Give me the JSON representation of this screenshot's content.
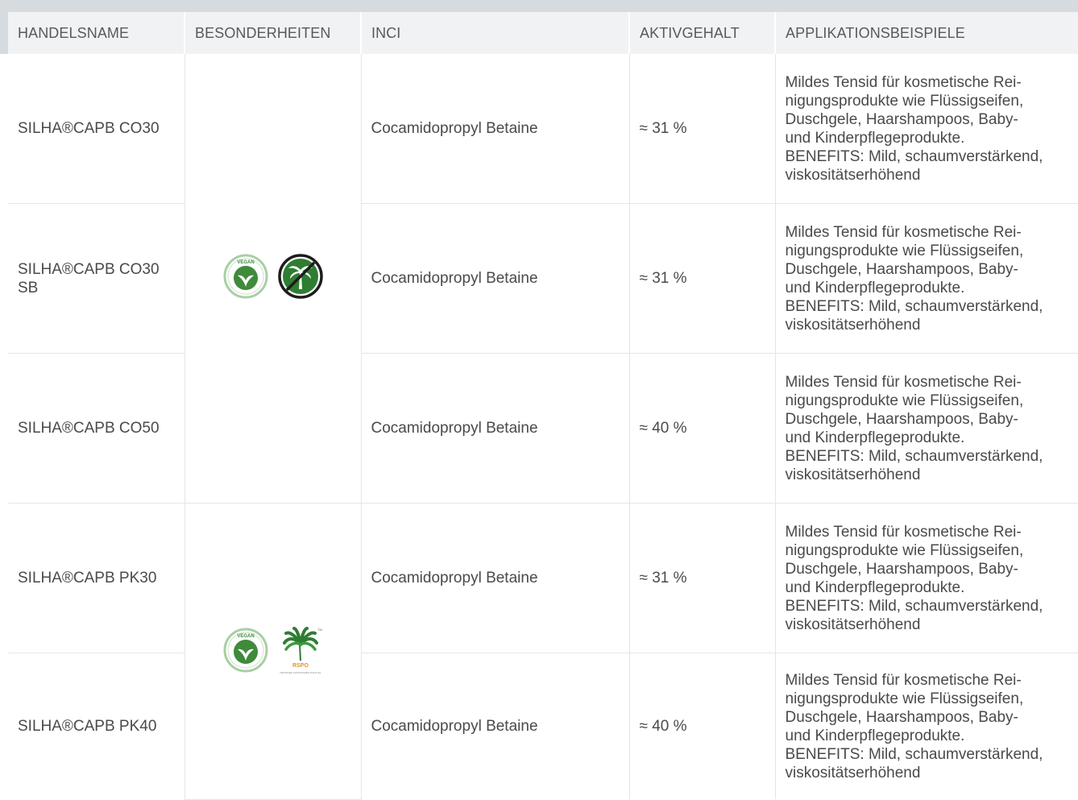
{
  "table": {
    "headers": [
      "HANDELSNAME",
      "BESONDERHEITEN",
      "INCI",
      "AKTIVGEHALT",
      "APPLIKATIONSBEISPIELE"
    ],
    "rows": [
      {
        "name": "SILHA®CAPB CO30",
        "inci": "Cocamidopropyl Betaine",
        "active": "≈ 31 %",
        "application": "Mildes Tensid für kosmetische Rei-\nnigungsprodukte wie Flüssigseifen,\nDuschgele, Haarshampoos, Baby-\nund Kinderpflegeprodukte.\nBENEFITS: Mild, schaumverstärkend,\nviskositätserhöhend"
      },
      {
        "name": "SILHA®CAPB CO30 SB",
        "inci": "Cocamidopropyl Betaine",
        "active": "≈ 31 %",
        "application": "Mildes Tensid für kosmetische Rei-\nnigungsprodukte wie Flüssigseifen,\nDuschgele, Haarshampoos, Baby-\nund Kinderpflegeprodukte.\nBENEFITS: Mild, schaumverstärkend,\nviskositätserhöhend"
      },
      {
        "name": "SILHA®CAPB CO50",
        "inci": "Cocamidopropyl Betaine",
        "active": "≈ 40 %",
        "application": "Mildes Tensid für kosmetische Rei-\nnigungsprodukte wie Flüssigseifen,\nDuschgele, Haarshampoos, Baby-\nund Kinderpflegeprodukte.\nBENEFITS: Mild, schaumverstärkend,\nviskositätserhöhend"
      },
      {
        "name": "SILHA®CAPB PK30",
        "inci": "Cocamidopropyl Betaine",
        "active": "≈ 31 %",
        "application": "Mildes Tensid für kosmetische Rei-\nnigungsprodukte wie Flüssigseifen,\nDuschgele, Haarshampoos, Baby-\nund Kinderpflegeprodukte.\nBENEFITS: Mild, schaumverstärkend,\nviskositätserhöhend"
      },
      {
        "name": "SILHA®CAPB PK40",
        "inci": "Cocamidopropyl Betaine",
        "active": "≈ 40 %",
        "application": "Mildes Tensid für kosmetische Rei-\nnigungsprodukte wie Flüssigseifen,\nDuschgele, Haarshampoos, Baby-\nund Kinderpflegeprodukte.\nBENEFITS: Mild, schaumverstärkend,\nviskositätserhöhend"
      }
    ],
    "badge_groups": [
      {
        "icons": [
          "vegan-icon",
          "palm-free-icon"
        ],
        "vegan_text": "VEGAN"
      },
      {
        "icons": [
          "vegan-icon",
          "rspo-icon"
        ],
        "vegan_text": "VEGAN",
        "rspo_text": "RSPO",
        "rspo_arc_text": "CERTIFIED SUSTAINABLE PALM OIL",
        "rspo_tm": "TM"
      }
    ]
  },
  "colors": {
    "vegan_green": "#3f8a3b",
    "vegan_ring": "#8fc08a",
    "palm_green": "#2f7d32",
    "rspo_orange": "#e8911c",
    "header_bg": "#f1f2f3",
    "frame_bg": "#d6dbe0"
  }
}
